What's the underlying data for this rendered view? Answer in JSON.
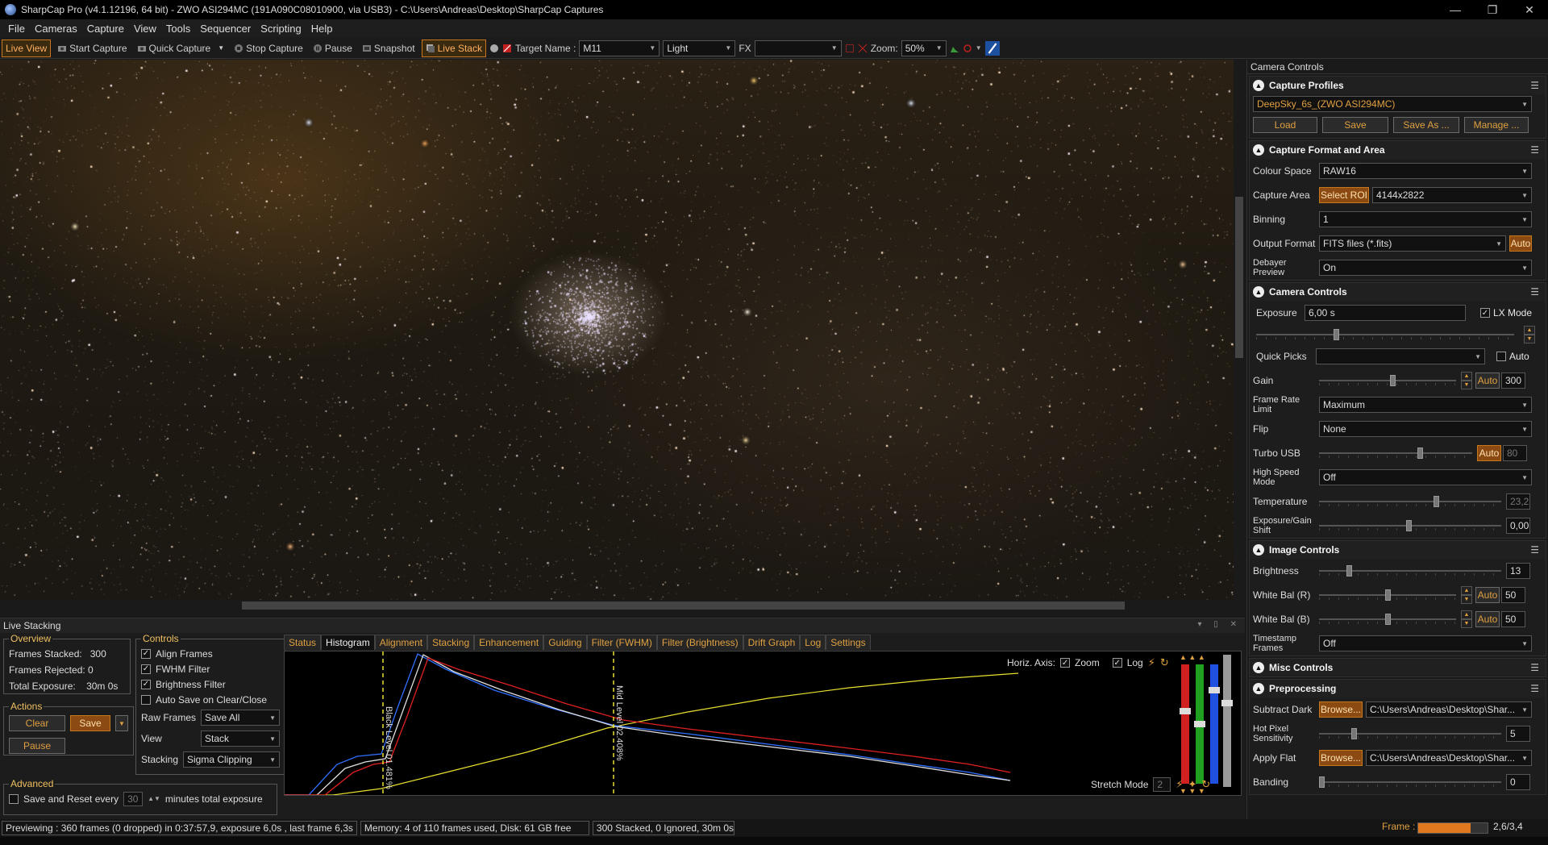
{
  "window": {
    "title": "SharpCap Pro (v4.1.12196, 64 bit) - ZWO ASI294MC (191A090C08010900, via USB3) - C:\\Users\\Andreas\\Desktop\\SharpCap Captures",
    "buttons": [
      "—",
      "❐",
      "✕"
    ]
  },
  "menu": [
    "File",
    "Cameras",
    "Capture",
    "View",
    "Tools",
    "Sequencer",
    "Scripting",
    "Help"
  ],
  "toolbar": {
    "live_view": "Live View",
    "start_capture": "Start Capture",
    "quick_capture": "Quick Capture",
    "stop_capture": "Stop Capture",
    "pause": "Pause",
    "snapshot": "Snapshot",
    "live_stack": "Live Stack",
    "target_label": "Target Name :",
    "target_value": "M11",
    "frame_type": "Light",
    "fx_label": "FX",
    "fx_value": "",
    "zoom_label": "Zoom:",
    "zoom_value": "50%"
  },
  "live_stacking": {
    "title": "Live Stacking",
    "overview": {
      "legend": "Overview",
      "frames_stacked_label": "Frames Stacked:",
      "frames_stacked": "300",
      "frames_rejected_label": "Frames Rejected:",
      "frames_rejected": "0",
      "total_exposure_label": "Total Exposure:",
      "total_exposure": "30m 0s"
    },
    "actions": {
      "legend": "Actions",
      "clear": "Clear",
      "save": "Save",
      "pause": "Pause"
    },
    "advanced": {
      "legend": "Advanced",
      "save_reset_label": "Save and Reset every",
      "minutes_value": "30",
      "minutes_label": "minutes total exposure"
    },
    "controls": {
      "legend": "Controls",
      "align_frames": "Align Frames",
      "fwhm_filter": "FWHM Filter",
      "brightness_filter": "Brightness Filter",
      "auto_save": "Auto Save on Clear/Close",
      "raw_frames_label": "Raw Frames",
      "raw_frames_value": "Save All",
      "view_label": "View",
      "view_value": "Stack",
      "stacking_label": "Stacking",
      "stacking_value": "Sigma Clipping"
    },
    "tabs": [
      "Status",
      "Histogram",
      "Alignment",
      "Stacking",
      "Enhancement",
      "Guiding",
      "Filter (FWHM)",
      "Filter (Brightness)",
      "Drift Graph",
      "Log",
      "Settings"
    ],
    "active_tab": "Histogram",
    "histogram": {
      "horiz_axis_label": "Horiz. Axis:",
      "zoom_label": "Zoom",
      "log_label": "Log",
      "black_level": "Black Level 01.481%",
      "mid_level": "Mid Level 02.408%",
      "stretch_mode_label": "Stretch Mode",
      "stretch_mode_value": "2"
    }
  },
  "status_bar": {
    "previewing": "Previewing : 360 frames (0 dropped) in 0:37:57,9, exposure 6,0s , last frame 6,3s",
    "memory": "Memory: 4 of 110 frames used, Disk: 61 GB free",
    "stacked": "300 Stacked, 0 Ignored, 30m 0s",
    "frame_label": "Frame :",
    "frame_value": "2,6/3,4",
    "frame_progress": 0.76
  },
  "right_panel": {
    "title": "Camera Controls",
    "capture_profiles": {
      "title": "Capture Profiles",
      "profile": "DeepSky_6s_(ZWO ASI294MC)",
      "load": "Load",
      "save": "Save",
      "save_as": "Save As ...",
      "manage": "Manage ..."
    },
    "capture_format": {
      "title": "Capture Format and Area",
      "colour_space_label": "Colour Space",
      "colour_space": "RAW16",
      "capture_area_label": "Capture Area",
      "select_roi": "Select ROI",
      "capture_area": "4144x2822",
      "binning_label": "Binning",
      "binning": "1",
      "output_format_label": "Output Format",
      "output_format": "FITS files (*.fits)",
      "output_auto": "Auto",
      "debayer_label": "Debayer Preview",
      "debayer": "On"
    },
    "camera_controls": {
      "title": "Camera Controls",
      "exposure_label": "Exposure",
      "exposure": "6,00 s",
      "lx_mode": "LX Mode",
      "quick_picks_label": "Quick Picks",
      "quick_picks": "",
      "quick_auto": "Auto",
      "gain_label": "Gain",
      "gain_auto": "Auto",
      "gain": "300",
      "frame_rate_label": "Frame Rate Limit",
      "frame_rate": "Maximum",
      "flip_label": "Flip",
      "flip": "None",
      "turbo_label": "Turbo USB",
      "turbo_auto": "Auto",
      "turbo": "80",
      "hsm_label": "High Speed Mode",
      "hsm": "Off",
      "temp_label": "Temperature",
      "temp": "23,2",
      "egs_label": "Exposure/Gain Shift",
      "egs": "0,00"
    },
    "image_controls": {
      "title": "Image Controls",
      "brightness_label": "Brightness",
      "brightness": "13",
      "wb_r_label": "White Bal (R)",
      "wb_r_auto": "Auto",
      "wb_r": "50",
      "wb_b_label": "White Bal (B)",
      "wb_b_auto": "Auto",
      "wb_b": "50",
      "timestamp_label": "Timestamp Frames",
      "timestamp": "Off"
    },
    "misc": {
      "title": "Misc Controls"
    },
    "preprocessing": {
      "title": "Preprocessing",
      "subtract_dark_label": "Subtract Dark",
      "browse": "Browse...",
      "dark_path": "C:\\Users\\Andreas\\Desktop\\Shar...",
      "hot_pixel_label": "Hot Pixel Sensitivity",
      "hot_pixel": "5",
      "apply_flat_label": "Apply Flat",
      "flat_path": "C:\\Users\\Andreas\\Desktop\\Shar...",
      "banding_label": "Banding",
      "banding": "0"
    }
  },
  "colors": {
    "accent": "#e0a040",
    "active_border": "#c8781a",
    "hist_red": "#e02020",
    "hist_green": "#e0e0e0",
    "hist_blue": "#3070ff",
    "hist_yellow": "#e8e030"
  }
}
